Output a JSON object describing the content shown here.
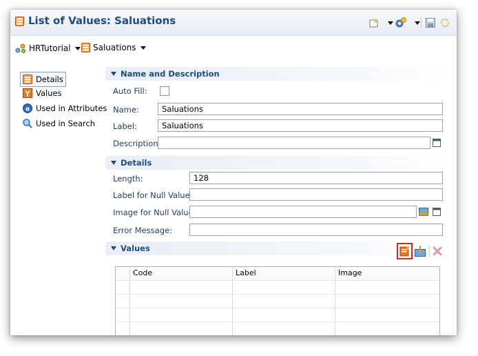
{
  "window": {
    "title": "List of Values: Saluations"
  },
  "breadcrumb": {
    "project": "HRTutorial",
    "object": "Saluations"
  },
  "nav": {
    "items": [
      {
        "label": "Details",
        "icon": "lov-details-icon"
      },
      {
        "label": "Values",
        "icon": "values-icon"
      },
      {
        "label": "Used in Attributes",
        "icon": "attribute-icon"
      },
      {
        "label": "Used in Search",
        "icon": "search-icon"
      }
    ]
  },
  "sections": {
    "name_description": {
      "title": "Name and Description",
      "auto_fill_label": "Auto Fill:",
      "name_label": "Name:",
      "name_value": "Saluations",
      "label_label": "Label:",
      "label_value": "Saluations",
      "description_label": "Description:",
      "description_value": ""
    },
    "details": {
      "title": "Details",
      "length_label": "Length:",
      "length_value": "128",
      "null_label_label": "Label for Null Value:",
      "null_label_value": "",
      "null_image_label": "Image for Null Value:",
      "null_image_value": "",
      "error_label": "Error Message:",
      "error_value": ""
    },
    "values": {
      "title": "Values",
      "columns": [
        "Code",
        "Label",
        "Image"
      ],
      "rows": [
        [
          "",
          "",
          ""
        ],
        [
          "",
          "",
          ""
        ],
        [
          "",
          "",
          ""
        ],
        [
          "",
          "",
          ""
        ]
      ]
    }
  },
  "colors": {
    "title_blue": "#1f4d80",
    "highlight_red": "#d22b1e"
  }
}
